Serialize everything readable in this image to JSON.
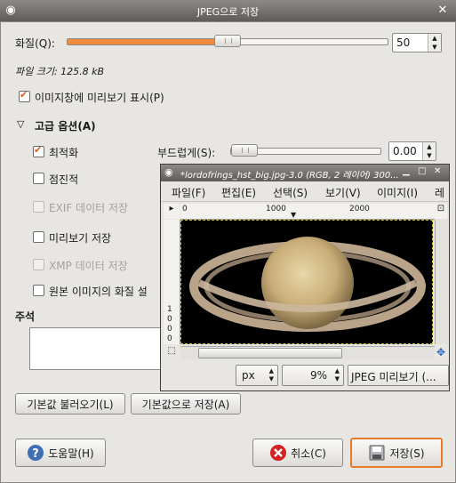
{
  "window": {
    "title": "JPEG으로 저장"
  },
  "quality": {
    "label": "화질(Q):",
    "value": "50",
    "percent": 50
  },
  "file_size": {
    "text": "파일 크기: 125.8 kB"
  },
  "show_preview": {
    "label": "이미지창에 미리보기 표시(P)",
    "checked": true
  },
  "advanced": {
    "header": "고급 옵션(A)",
    "optimize": {
      "label": "최적화",
      "checked": true
    },
    "smoothing": {
      "label": "부드럽게(S):",
      "value": "0.00",
      "percent": 0
    },
    "progressive": {
      "label": "점진적",
      "checked": false
    },
    "save_exif": {
      "label": "EXIF 데이터 저장",
      "checked": false,
      "enabled": false
    },
    "save_thumbnail": {
      "label": "미리보기 저장",
      "checked": false
    },
    "save_xmp": {
      "label": "XMP 데이터 저장",
      "checked": false,
      "enabled": false
    },
    "use_original_quality": {
      "label": "원본 이미지의 화질 설",
      "checked": false
    }
  },
  "comment": {
    "label": "주석",
    "value": ""
  },
  "buttons": {
    "load_defaults": "기본값 불러오기(L)",
    "save_defaults": "기본값으로 저장(A)",
    "help": "도움말(H)",
    "cancel": "취소(C)",
    "save": "저장(S)"
  },
  "preview_window": {
    "title": "*lordofrings_hst_big.jpg-3.0 (RGB, 2 레이어) 300...",
    "menu": [
      "파일(F)",
      "편집(E)",
      "선택(S)",
      "보기(V)",
      "이미지(I)",
      "레"
    ],
    "ruler_h": [
      "0",
      "1000",
      "2000"
    ],
    "ruler_v": [
      "1",
      "0",
      "0",
      "0"
    ],
    "unit": "px",
    "zoom": "9%",
    "status": "JPEG 미리보기 (..."
  },
  "colors": {
    "accent": "#f08a3c",
    "default_border": "#e87a2b",
    "checkmark": "#d2601a"
  }
}
